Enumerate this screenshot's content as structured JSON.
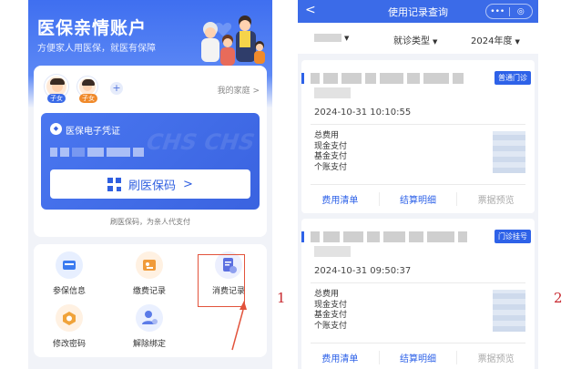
{
  "left": {
    "app_title": "医保亲情账户",
    "app_subtitle": "方便家人用医保，就医有保障",
    "members": [
      {
        "tag": "子女",
        "tag_color": "#3b6be8"
      },
      {
        "tag": "子女",
        "tag_color": "#f08a2b"
      }
    ],
    "add_member": "+",
    "my_family": "我的家庭 >",
    "cert_title": "医保电子凭证",
    "cert_watermark": "CHS CHS",
    "scan_button": "刷医保码",
    "scan_chevron": ">",
    "scan_tip": "刷医保码，为亲人代支付",
    "functions": [
      {
        "label": "参保信息",
        "icon": "id-card-icon",
        "color": "#3b7bf0"
      },
      {
        "label": "缴费记录",
        "icon": "wallet-icon",
        "color": "#f09b3a"
      },
      {
        "label": "消费记录",
        "icon": "receipt-icon",
        "color": "#5b6fe0"
      },
      {
        "label": "修改密码",
        "icon": "lock-icon",
        "color": "#f0a33a"
      },
      {
        "label": "解除绑定",
        "icon": "user-unbind-icon",
        "color": "#5b7be8"
      }
    ],
    "accent_color": "#3b6be8",
    "highlight_color": "#e2533c"
  },
  "right": {
    "nav_back": "<",
    "nav_title": "使用记录查询",
    "capsule_more": "•••",
    "capsule_close": "◎",
    "filters": {
      "type": "就诊类型",
      "year": "2024年度"
    },
    "records": [
      {
        "tag": "普通门诊",
        "time": "2024-10-31 10:10:55",
        "fees": [
          "总费用",
          "现金支付",
          "基金支付",
          "个账支付"
        ],
        "actions": [
          "费用清单",
          "结算明细",
          "票据预览"
        ]
      },
      {
        "tag": "门诊挂号",
        "time": "2024-10-31 09:50:37",
        "fees": [
          "总费用",
          "现金支付",
          "基金支付",
          "个账支付"
        ],
        "actions": [
          "费用清单",
          "结算明细",
          "票据预览"
        ]
      }
    ]
  },
  "annotations": {
    "step_1": "1",
    "step_2": "2"
  }
}
